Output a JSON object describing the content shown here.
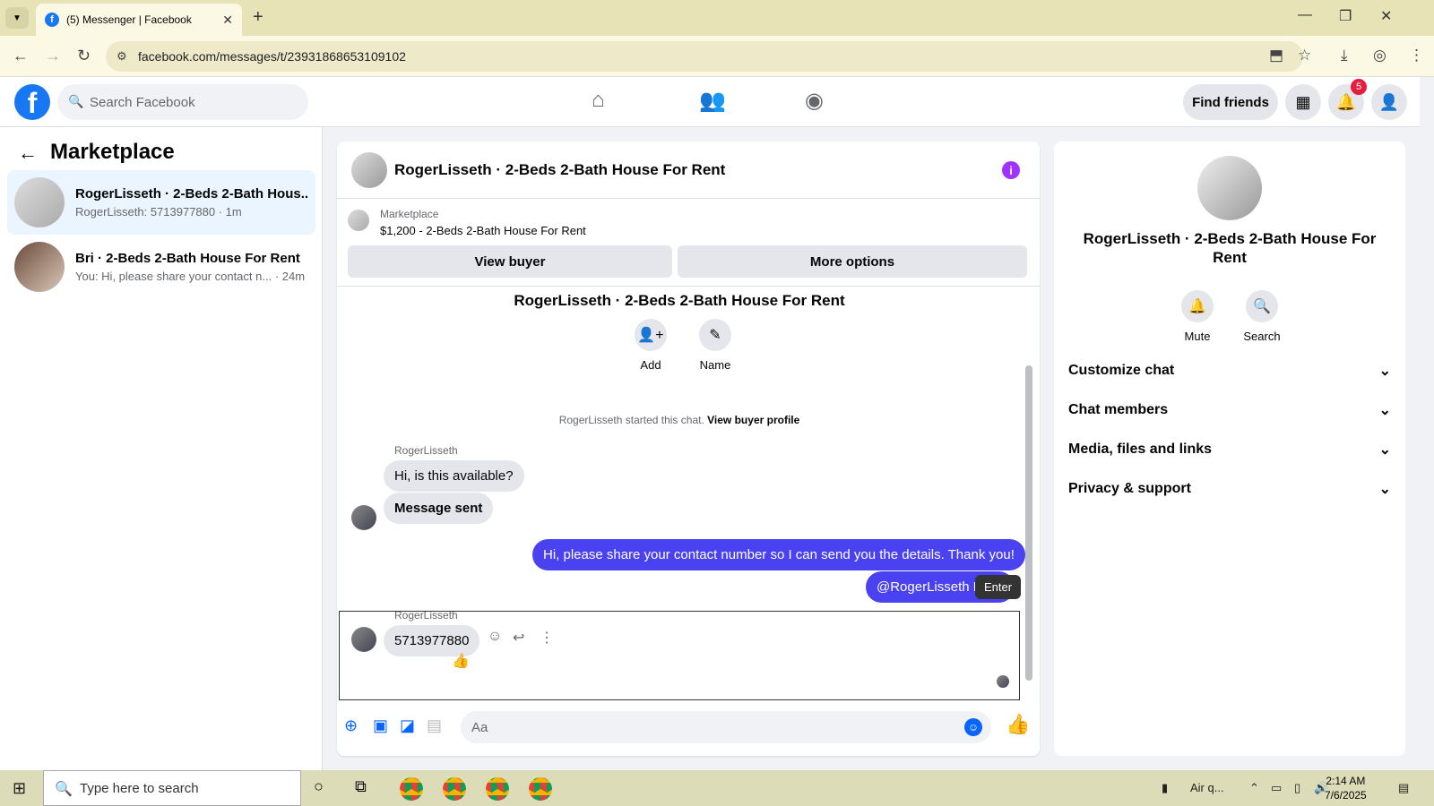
{
  "browser": {
    "tab_title": "(5) Messenger | Facebook",
    "url": "facebook.com/messages/t/23931868653109102"
  },
  "fb": {
    "search_placeholder": "Search Facebook",
    "find_friends": "Find friends",
    "notification_count": "5"
  },
  "left": {
    "title": "Marketplace",
    "conversations": [
      {
        "name": "RogerLisseth · 2-Beds 2-Bath Hous...",
        "sub": "RogerLisseth: 5713977880 · 1m"
      },
      {
        "name": "Bri · 2-Beds 2-Bath House For Rent",
        "sub": "You: Hi, please share your contact n... · 24m"
      }
    ]
  },
  "chat": {
    "header_title": "RogerLisseth · 2-Beds 2-Bath House For Rent",
    "marketplace_label": "Marketplace",
    "listing": "$1,200 - 2-Beds 2-Bath House For Rent",
    "view_buyer": "View buyer",
    "more_options": "More options",
    "center_title": "RogerLisseth · 2-Beds 2-Bath House For Rent",
    "add_label": "Add",
    "name_label": "Name",
    "system_text": "RogerLisseth started this chat.",
    "system_link": "View buyer profile",
    "sender1": "RogerLisseth",
    "msg1": "Hi, is this available?",
    "msg2": "Message sent",
    "out1": "Hi, please share your contact number so I can send you the details. Thank you!",
    "out2": "@RogerLisseth Fi",
    "tooltip": "Enter",
    "sender2": "RogerLisseth",
    "msg3": "5713977880",
    "composer_placeholder": "Aa"
  },
  "right": {
    "title": "RogerLisseth · 2-Beds 2-Bath House For Rent",
    "mute": "Mute",
    "search": "Search",
    "items": [
      "Customize chat",
      "Chat members",
      "Media, files and links",
      "Privacy & support"
    ]
  },
  "taskbar": {
    "search_placeholder": "Type here to search",
    "air": "Air q...",
    "time": "2:14 AM",
    "date": "7/6/2025"
  },
  "colors": {
    "fb_blue": "#1877f2",
    "outgoing_bubble": "#4a41f0",
    "active_conversation": "#ebf5ff",
    "chrome_bar": "#e8e3b7"
  }
}
